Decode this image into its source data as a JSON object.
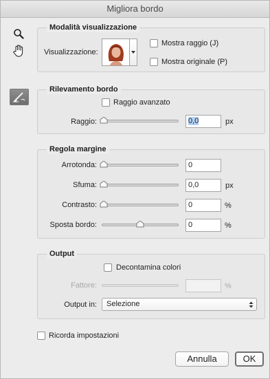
{
  "window": {
    "title": "Migliora bordo"
  },
  "tools": {
    "zoom": "zoom-icon",
    "hand": "hand-icon",
    "brush": "refine-radius-brush-icon"
  },
  "view_mode": {
    "legend": "Modalità visualizzazione",
    "view_label": "Visualizzazione:",
    "show_radius": {
      "label": "Mostra raggio (J)",
      "checked": false
    },
    "show_original": {
      "label": "Mostra originale (P)",
      "checked": false
    }
  },
  "edge_detection": {
    "legend": "Rilevamento bordo",
    "smart_radius": {
      "label": "Raggio avanzato",
      "checked": false
    },
    "radius": {
      "label": "Raggio:",
      "value": "0,0",
      "unit": "px",
      "slider": 0
    }
  },
  "adjust_edge": {
    "legend": "Regola margine",
    "smooth": {
      "label": "Arrotonda:",
      "value": "0",
      "unit": "",
      "slider": 0
    },
    "feather": {
      "label": "Sfuma:",
      "value": "0,0",
      "unit": "px",
      "slider": 0
    },
    "contrast": {
      "label": "Contrasto:",
      "value": "0",
      "unit": "%",
      "slider": 0
    },
    "shift_edge": {
      "label": "Sposta bordo:",
      "value": "0",
      "unit": "%",
      "slider": 0.5
    }
  },
  "output": {
    "legend": "Output",
    "decontaminate": {
      "label": "Decontamina colori",
      "checked": false
    },
    "amount": {
      "label": "Fattore:",
      "value": "",
      "unit": "%"
    },
    "output_to": {
      "label": "Output in:",
      "value": "Selezione"
    }
  },
  "remember": {
    "label": "Ricorda impostazioni",
    "checked": false
  },
  "buttons": {
    "cancel": "Annulla",
    "ok": "OK"
  }
}
